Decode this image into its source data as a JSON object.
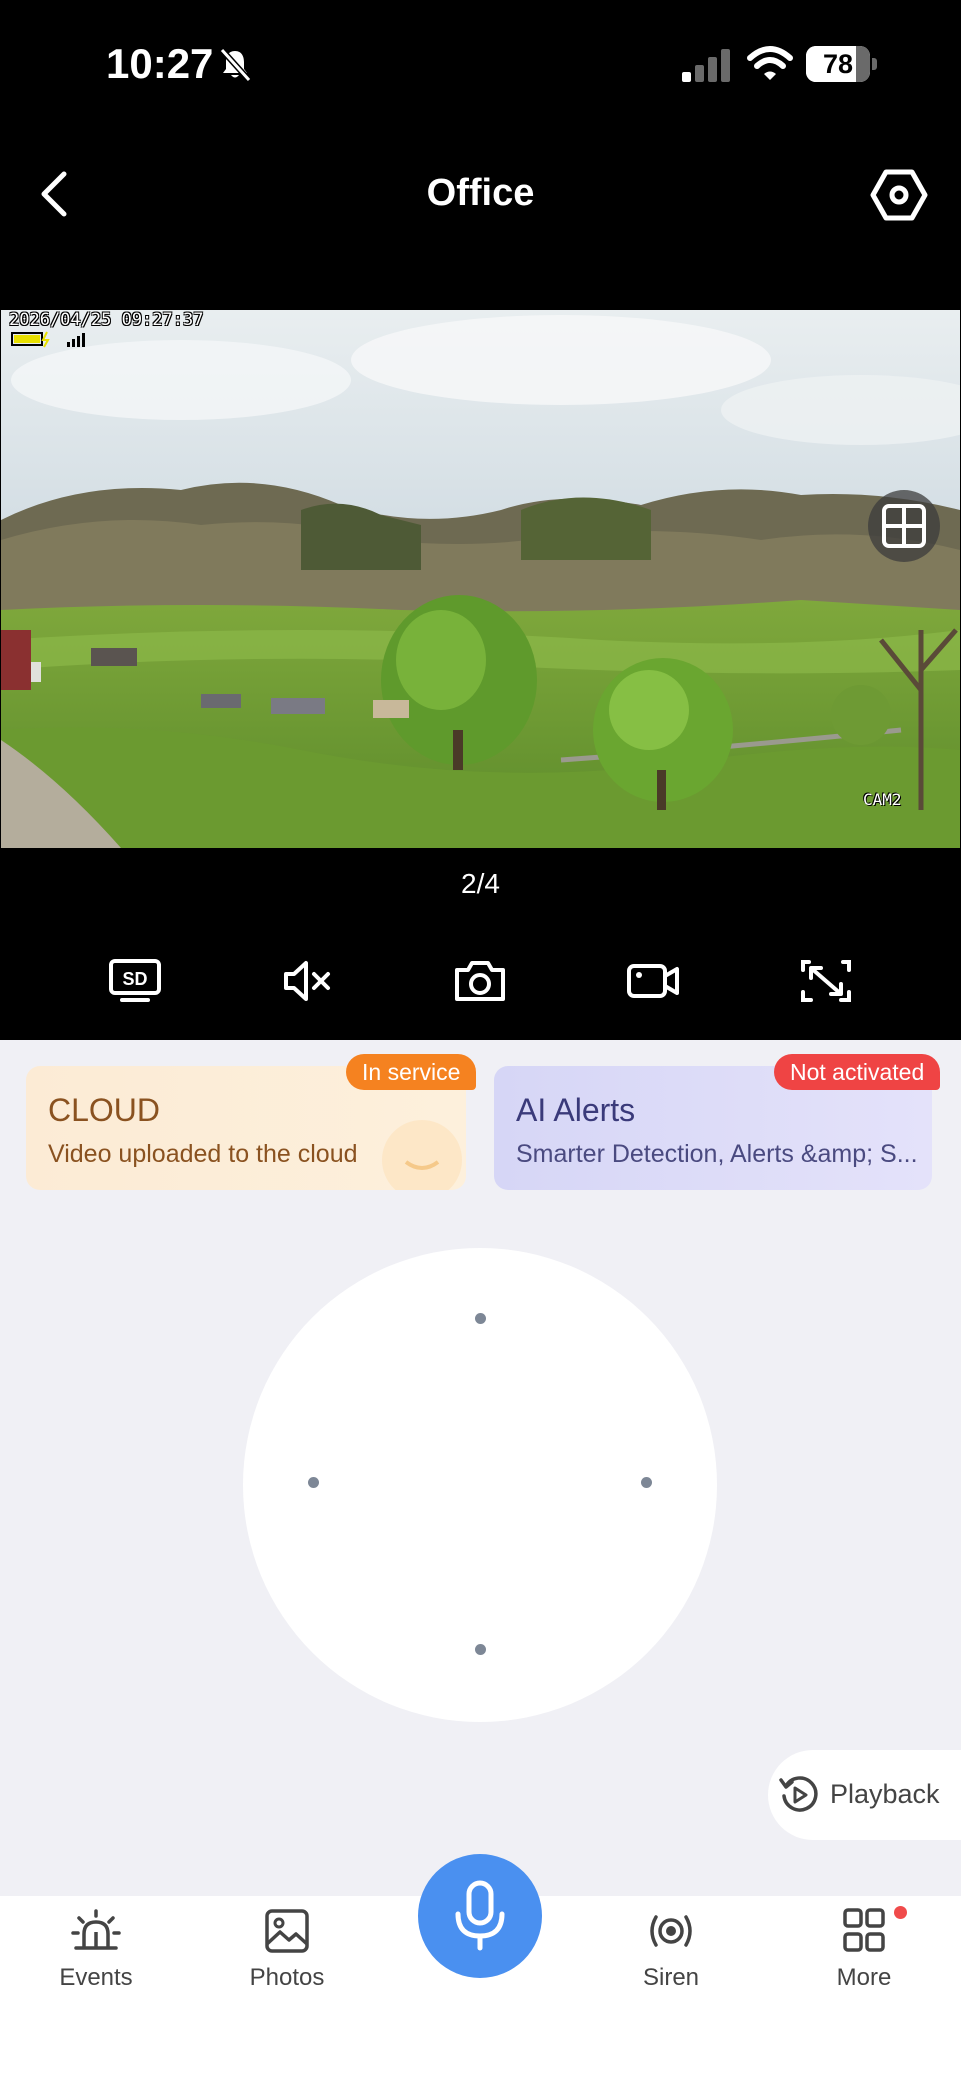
{
  "status_bar": {
    "time": "10:27",
    "battery": "78"
  },
  "header": {
    "title": "Office"
  },
  "video": {
    "timestamp": "2026/04/25 09:27:37",
    "camera_label": "CAM2"
  },
  "page_indicator": "2/4",
  "cards": {
    "cloud": {
      "title": "CLOUD",
      "subtitle": "Video uploaded to the cloud",
      "badge": "In service"
    },
    "ai": {
      "title": "AI Alerts",
      "subtitle": "Smarter Detection, Alerts &amp; S...",
      "badge": "Not activated"
    }
  },
  "playback": {
    "label": "Playback"
  },
  "nav": {
    "events": "Events",
    "photos": "Photos",
    "siren": "Siren",
    "more": "More"
  },
  "colors": {
    "accent": "#4a90f0",
    "badge_orange": "#f58220",
    "badge_red": "#ef4444"
  }
}
